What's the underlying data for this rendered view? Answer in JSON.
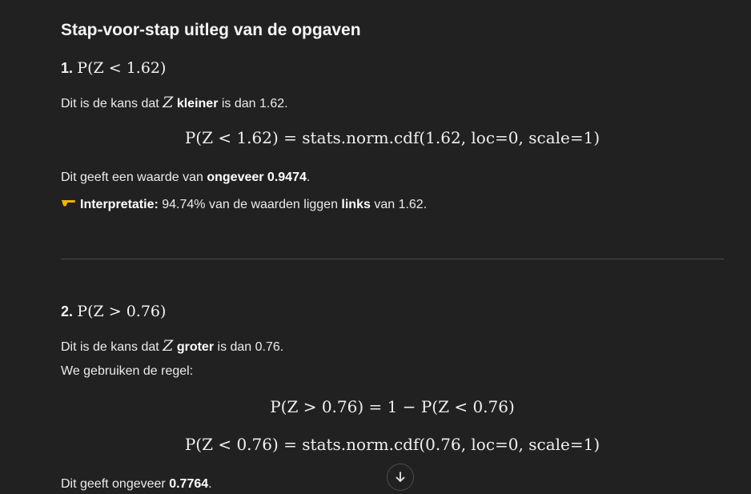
{
  "title": "Stap-voor-stap uitleg van de opgaven",
  "step1": {
    "number": "1.",
    "heading_math": "P(Z < 1.62)",
    "line1": {
      "pre": "Dit is de kans dat ",
      "var": "Z",
      "bold": "kleiner",
      "post": " is dan 1.62."
    },
    "formula": "P(Z < 1.62) = stats.norm.cdf(1.62, loc=0, scale=1)",
    "result": {
      "pre": "Dit geeft een waarde van ",
      "bold": "ongeveer 0.9474",
      "post": "."
    },
    "interpretation": {
      "icon": "pointing-hand-icon",
      "label": "Interpretatie:",
      "text_pre": " 94.74% van de waarden liggen ",
      "bold": "links",
      "text_post": " van 1.62."
    }
  },
  "step2": {
    "number": "2.",
    "heading_math": "P(Z > 0.76)",
    "line1": {
      "pre": "Dit is de kans dat ",
      "var": "Z",
      "bold": "groter",
      "post": " is dan 0.76."
    },
    "line2": "We gebruiken de regel:",
    "formula1": "P(Z > 0.76) = 1 − P(Z < 0.76)",
    "formula2": "P(Z < 0.76) = stats.norm.cdf(0.76, loc=0, scale=1)",
    "result": {
      "pre": "Dit geeft ongeveer ",
      "bold": "0.7764",
      "post": "."
    }
  },
  "scroll_button": {
    "icon": "arrow-down-icon"
  }
}
